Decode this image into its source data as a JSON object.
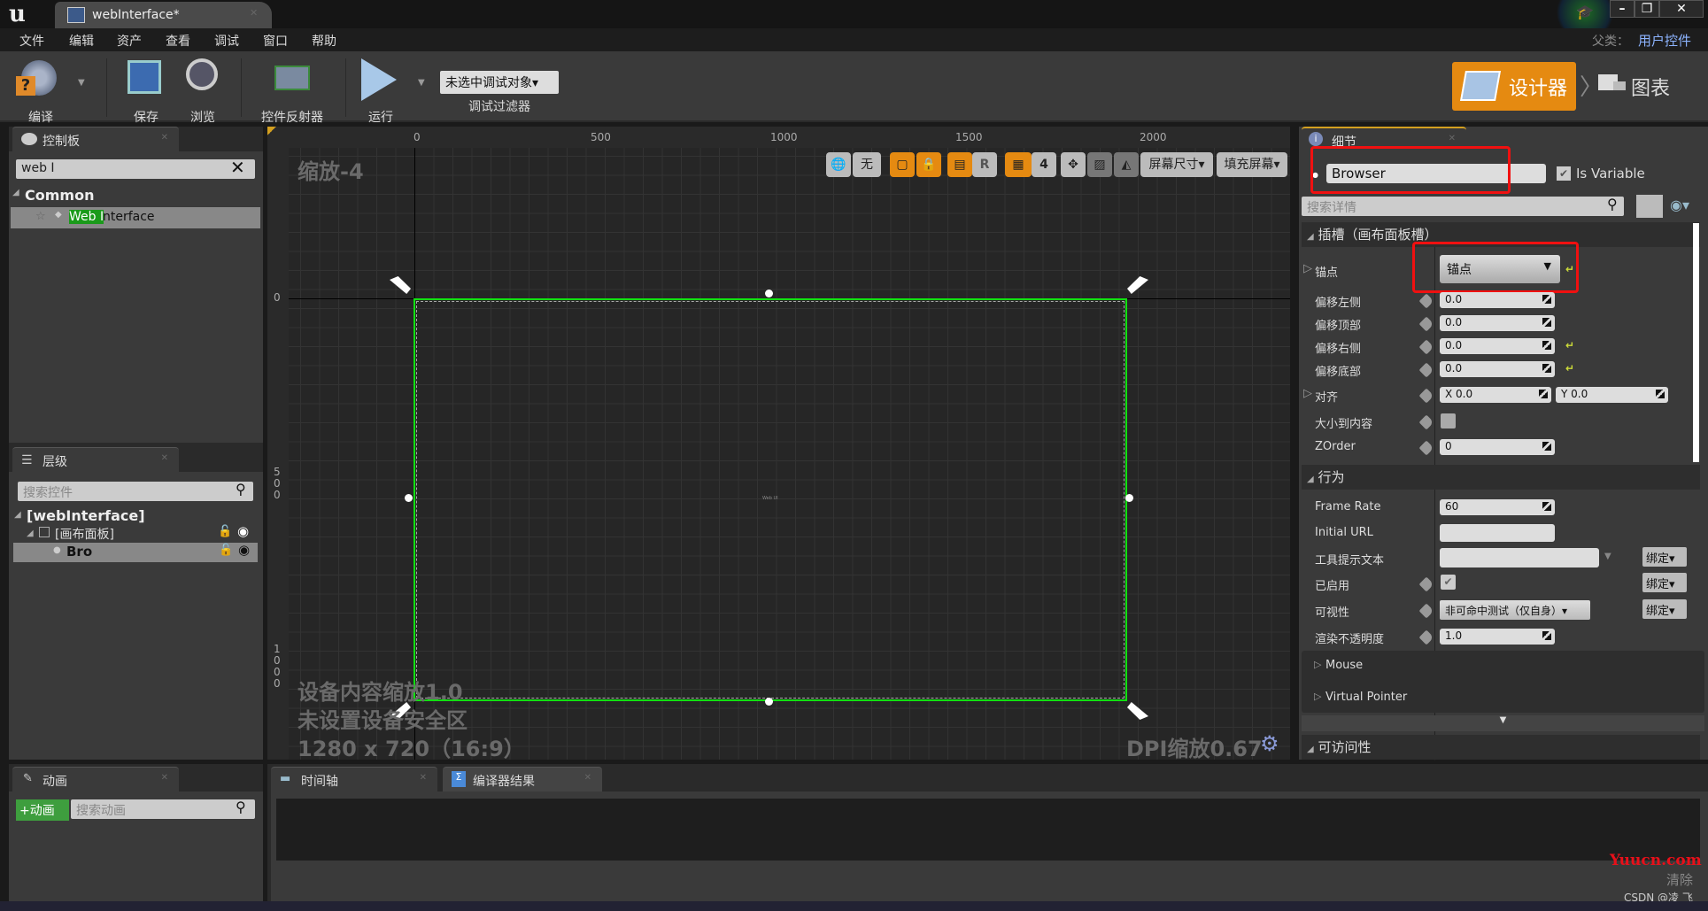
{
  "window": {
    "tab_title": "webInterface*",
    "parent_label": "父类：",
    "parent_value": "用户控件",
    "minimize": "–",
    "restore": "❐",
    "close": "✕"
  },
  "menu": [
    "文件",
    "编辑",
    "资产",
    "查看",
    "调试",
    "窗口",
    "帮助"
  ],
  "toolbar": {
    "compile": "编译",
    "save": "保存",
    "browse": "浏览",
    "widget_reflector": "控件反射器",
    "play": "运行",
    "debug_target": "未选中调试对象▾",
    "debug_filter": "调试过滤器",
    "designer": "设计器",
    "graph": "图表"
  },
  "palette": {
    "tab": "控制板",
    "search_value": "web I",
    "category": "Common",
    "items": [
      {
        "highlight": "Web I",
        "rest": "nterface"
      }
    ]
  },
  "hierarchy": {
    "tab": "层级",
    "search_placeholder": "搜索控件",
    "root": "[webInterface]",
    "canvas": "[画布面板]",
    "child": "Bro"
  },
  "canvas": {
    "zoom_label": "缩放-4",
    "ruler_top": [
      "0",
      "500",
      "1000",
      "1500",
      "2000"
    ],
    "ruler_left": [
      "0",
      "500",
      "1000"
    ],
    "toolbar": {
      "world": "🌐",
      "none": "无",
      "grid_snap": "4",
      "screen_size": "屏幕尺寸▾",
      "fill_screen": "填充屏幕▾",
      "r": "R"
    },
    "widget_label": "Web UI",
    "device_scale": "设备内容缩放1.0",
    "safe_zone": "未设置设备安全区",
    "resolution": "1280 x 720（16:9）",
    "dpi": "DPI缩放0.67"
  },
  "details": {
    "tab": "细节",
    "name_value": "Browser",
    "is_variable_label": "Is Variable",
    "is_variable": true,
    "search_placeholder": "搜索详情",
    "slot_section": "插槽（画布面板槽）",
    "anchor_label": "锚点",
    "anchor_value": "锚点",
    "offset_left": {
      "label": "偏移左侧",
      "value": "0.0"
    },
    "offset_top": {
      "label": "偏移顶部",
      "value": "0.0"
    },
    "offset_right": {
      "label": "偏移右侧",
      "value": "0.0"
    },
    "offset_bottom": {
      "label": "偏移底部",
      "value": "0.0"
    },
    "alignment": {
      "label": "对齐",
      "x": "X  0.0",
      "y": "Y  0.0"
    },
    "size_to_content": {
      "label": "大小到内容",
      "checked": false
    },
    "zorder": {
      "label": "ZOrder",
      "value": "0"
    },
    "behavior_section": "行为",
    "frame_rate": {
      "label": "Frame Rate",
      "value": "60"
    },
    "initial_url": {
      "label": "Initial URL",
      "value": ""
    },
    "tooltip": {
      "label": "工具提示文本",
      "value": ""
    },
    "enabled": {
      "label": "已启用",
      "checked": true
    },
    "visibility": {
      "label": "可视性",
      "value": "非可命中测试（仅自身）▾"
    },
    "opacity": {
      "label": "渲染不透明度",
      "value": "1.0"
    },
    "bind_label": "绑定▾",
    "mouse": "Mouse",
    "virtual_pointer": "Virtual Pointer",
    "accessibility_section": "可访问性"
  },
  "bottom": {
    "animation_tab": "动画",
    "add_animation": "+动画",
    "animation_search_placeholder": "搜索动画",
    "timeline_tab": "时间轴",
    "compiler_tab": "编译器结果",
    "clear": "清除"
  },
  "watermarks": {
    "yuucn": "Yuucn.com",
    "csdn": "CSDN @凌 飞"
  }
}
